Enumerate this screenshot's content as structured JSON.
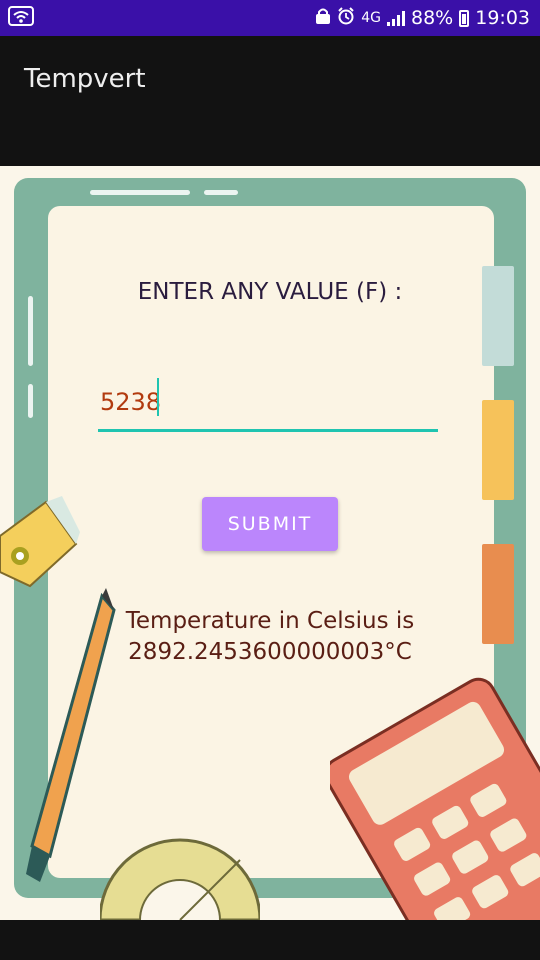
{
  "status_bar": {
    "network": "4G",
    "battery": "88%",
    "time": "19:03",
    "icons": [
      "wifi-icon",
      "lock-icon",
      "alarm-icon",
      "signal-icon",
      "battery-icon"
    ]
  },
  "app_bar": {
    "title": "Tempvert"
  },
  "form": {
    "prompt": "ENTER ANY VALUE (F) :",
    "input_value": "5238",
    "submit_label": "SUBMIT"
  },
  "result": {
    "line1": "Temperature in Celsius is",
    "line2": "2892.2453600000003°C"
  },
  "colors": {
    "status_bar": "#3a10a8",
    "accent": "#bb86fc",
    "input_underline": "#1fc4b0",
    "input_text": "#b23a0e",
    "result_text": "#5a1e14"
  }
}
